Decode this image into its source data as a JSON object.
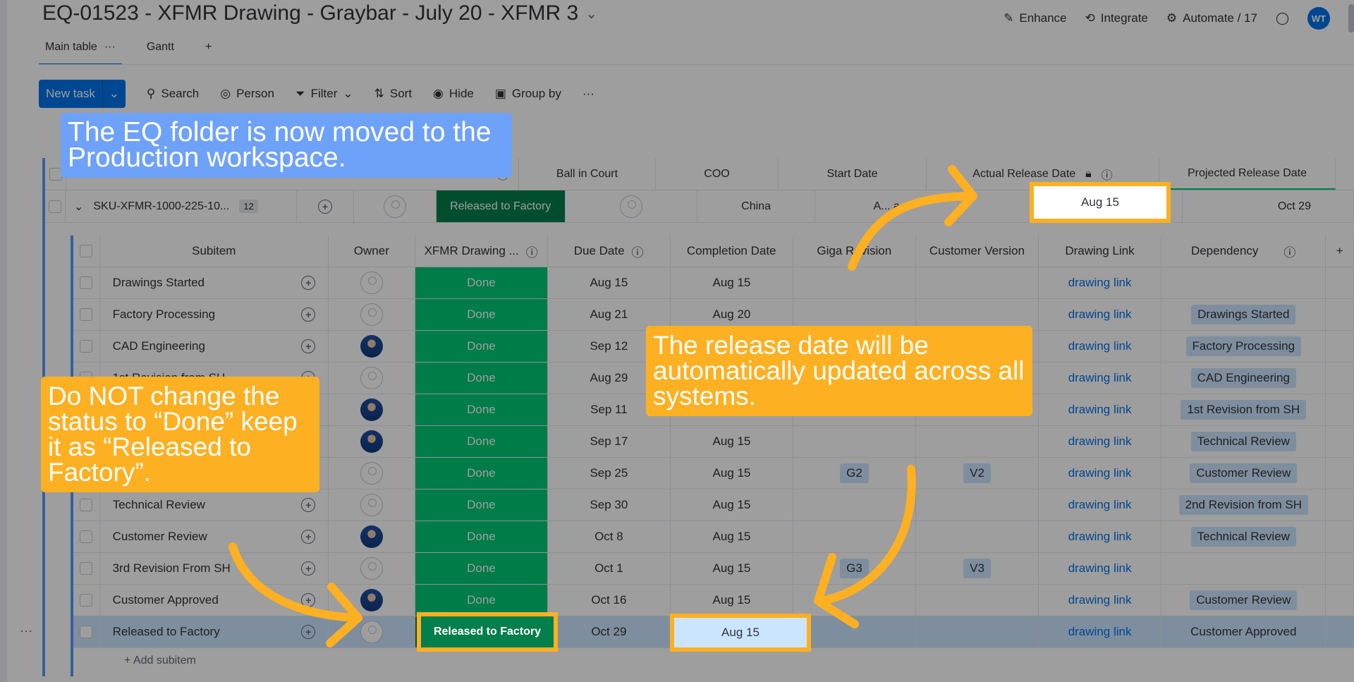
{
  "board": {
    "title": "EQ-01523 - XFMR Drawing - Graybar - July 20 - XFMR 3"
  },
  "topbar": {
    "enhance": "Enhance",
    "integrate": "Integrate",
    "automate": "Automate / 17",
    "avatar": "WT"
  },
  "tabs": [
    {
      "label": "Main table",
      "more": "···"
    },
    {
      "label": "Gantt"
    },
    {
      "label": "+"
    }
  ],
  "toolbar": {
    "new_task": "New task",
    "search": "Search",
    "person": "Person",
    "filter": "Filter",
    "sort": "Sort",
    "hide": "Hide",
    "group_by": "Group by",
    "more": "···"
  },
  "main_columns": {
    "ball_in_court": "Ball in Court",
    "coo": "COO",
    "start_date": "Start Date",
    "actual_release": "Actual Release Date",
    "projected_release": "Projected Release Date"
  },
  "item": {
    "name": "SKU-XFMR-1000-225-10...",
    "count": "12",
    "status": "Released to Factory",
    "coo": "China",
    "start_date": "A... a",
    "actual_release": "Aug 15",
    "projected_release": "Oct 29"
  },
  "sub_columns": {
    "subitem": "Subitem",
    "owner": "Owner",
    "status": "XFMR Drawing ...",
    "due": "Due Date",
    "completion": "Completion Date",
    "giga": "Giga Revision",
    "customer_version": "Customer Version",
    "drawing_link": "Drawing Link",
    "dependency": "Dependency",
    "plus": "+"
  },
  "subitems": [
    {
      "name": "Drawings Started",
      "owner": "empty",
      "status": "Done",
      "due": "Aug 15",
      "completion": "Aug 15",
      "giga": "",
      "cust": "",
      "link": "drawing link",
      "dep": ""
    },
    {
      "name": "Factory Processing",
      "owner": "empty",
      "status": "Done",
      "due": "Aug 21",
      "completion": "Aug 20",
      "giga": "",
      "cust": "",
      "link": "drawing link",
      "dep": "Drawings Started"
    },
    {
      "name": "CAD Engineering",
      "owner": "photo",
      "status": "Done",
      "due": "Sep 12",
      "completion": "",
      "giga": "",
      "cust": "",
      "link": "drawing link",
      "dep": "Factory Processing"
    },
    {
      "name": "1st Revision from SH",
      "owner": "empty",
      "status": "Done",
      "due": "Aug 29",
      "completion": "",
      "giga": "",
      "cust": "",
      "link": "drawing link",
      "dep": "CAD Engineering"
    },
    {
      "name": "",
      "owner": "photo",
      "status": "Done",
      "due": "Sep 11",
      "completion": "",
      "giga": "",
      "cust": "",
      "link": "drawing link",
      "dep": "1st Revision from SH"
    },
    {
      "name": "",
      "owner": "photo",
      "status": "Done",
      "due": "Sep 17",
      "completion": "Aug 15",
      "giga": "",
      "cust": "",
      "link": "drawing link",
      "dep": "Technical Review"
    },
    {
      "name": "",
      "owner": "empty",
      "status": "Done",
      "due": "Sep 25",
      "completion": "Aug 15",
      "giga": "G2",
      "cust": "V2",
      "link": "drawing link",
      "dep": "Customer Review"
    },
    {
      "name": "Technical Review",
      "owner": "empty",
      "status": "Done",
      "due": "Sep 30",
      "completion": "Aug 15",
      "giga": "",
      "cust": "",
      "link": "drawing link",
      "dep": "2nd Revision from SH"
    },
    {
      "name": "Customer Review",
      "owner": "photo",
      "status": "Done",
      "due": "Oct 8",
      "completion": "Aug 15",
      "giga": "",
      "cust": "",
      "link": "drawing link",
      "dep": "Technical Review"
    },
    {
      "name": "3rd Revision From SH",
      "owner": "empty",
      "status": "Done",
      "due": "Oct 1",
      "completion": "Aug 15",
      "giga": "G3",
      "cust": "V3",
      "link": "drawing link",
      "dep": ""
    },
    {
      "name": "Customer Approved",
      "owner": "photo",
      "status": "Done",
      "due": "Oct 16",
      "completion": "Aug 15",
      "giga": "",
      "cust": "",
      "link": "drawing link",
      "dep": "Customer Review"
    },
    {
      "name": "Released to Factory",
      "owner": "empty",
      "status": "Released to Factory",
      "due": "Oct 29",
      "completion": "Aug 15",
      "giga": "",
      "cust": "",
      "link": "drawing link",
      "dep": "Customer Approved"
    }
  ],
  "add_subitem": "+ Add subitem",
  "side_dots": "···",
  "callouts": {
    "blue": "The EQ folder is now moved to the Production workspace.",
    "release": "The release date will be automatically updated across all systems.",
    "status": "Do NOT change the status to “Done” keep it as “Released to Factory”."
  },
  "colors": {
    "done": "#00c875",
    "released": "#037f4c",
    "accent": "#0073ea",
    "callout_orange": "#fdb022",
    "callout_blue": "#6ea1f8"
  }
}
